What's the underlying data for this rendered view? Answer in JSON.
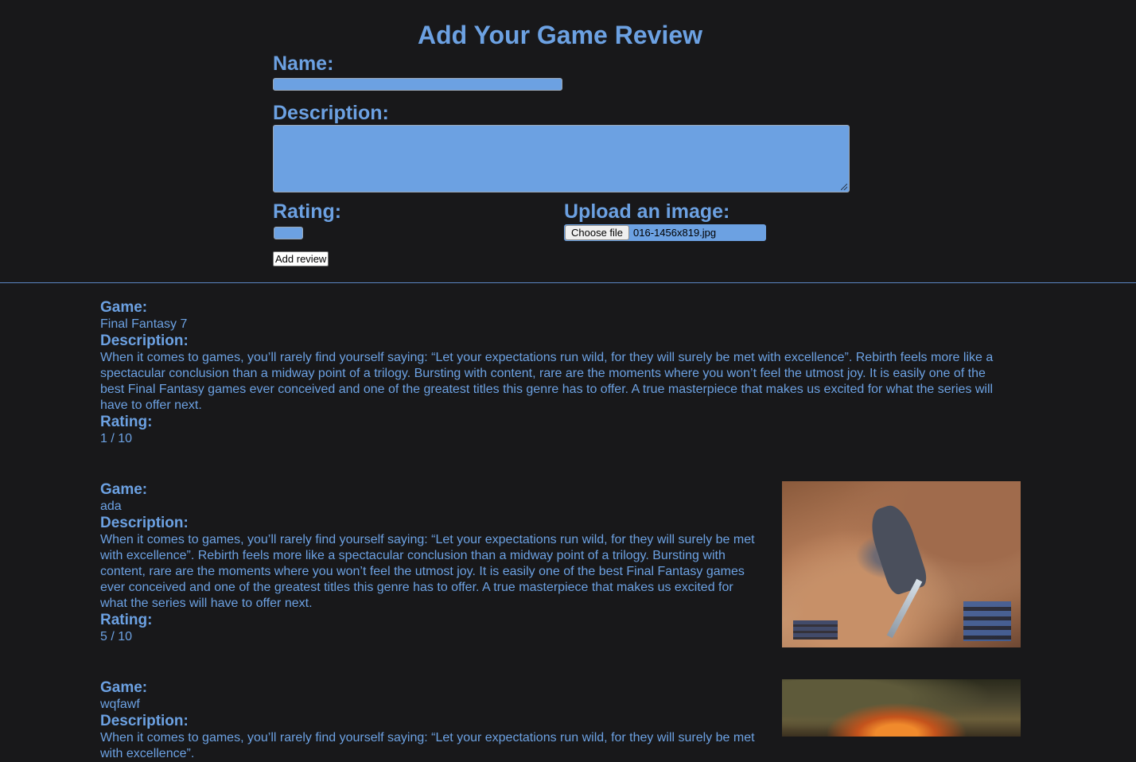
{
  "form": {
    "title": "Add Your Game Review",
    "name_label": "Name:",
    "name_value": "",
    "description_label": "Description:",
    "description_value": "",
    "rating_label": "Rating:",
    "rating_value": "",
    "upload_label": "Upload an image:",
    "choose_file_label": "Choose file",
    "file_name": "016-1456x819.jpg",
    "submit_label": "Add review"
  },
  "review_labels": {
    "game": "Game:",
    "description": "Description:",
    "rating": "Rating:"
  },
  "reviews": [
    {
      "game": "Final Fantasy 7",
      "description": "When it comes to games, you’ll rarely find yourself saying: “Let your expectations run wild, for they will surely be met with excellence”. Rebirth feels more like a spectacular conclusion than a midway point of a trilogy. Bursting with content, rare are the moments where you won’t feel the utmost joy. It is easily one of the best Final Fantasy games ever conceived and one of the greatest titles this genre has to offer. A true masterpiece that makes us excited for what the series will have to offer next.",
      "rating": "1 / 10"
    },
    {
      "game": "ada",
      "description": "When it comes to games, you’ll rarely find yourself saying: “Let your expectations run wild, for they will surely be met with excellence”. Rebirth feels more like a spectacular conclusion than a midway point of a trilogy. Bursting with content, rare are the moments where you won’t feel the utmost joy. It is easily one of the best Final Fantasy games ever conceived and one of the greatest titles this genre has to offer. A true masterpiece that makes us excited for what the series will have to offer next.",
      "rating": "5 / 10"
    },
    {
      "game": "wqfawf",
      "description": "When it comes to games, you’ll rarely find yourself saying: “Let your expectations run wild, for they will surely be met with excellence”."
    }
  ]
}
